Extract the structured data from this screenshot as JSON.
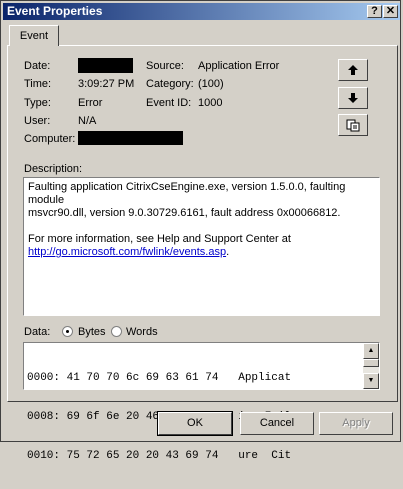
{
  "window": {
    "title": "Event Properties",
    "help_label": "?",
    "close_label": "✕"
  },
  "tabs": [
    {
      "label": "Event"
    }
  ],
  "event": {
    "date_label": "Date:",
    "date_value": "",
    "source_label": "Source:",
    "source_value": "Application Error",
    "time_label": "Time:",
    "time_value": "3:09:27 PM",
    "category_label": "Category:",
    "category_value": "(100)",
    "type_label": "Type:",
    "type_value": "Error",
    "event_id_label": "Event ID:",
    "event_id_value": "1000",
    "user_label": "User:",
    "user_value": "N/A",
    "computer_label": "Computer:",
    "computer_value": ""
  },
  "side_buttons": {
    "up_icon": "up-arrow-icon",
    "down_icon": "down-arrow-icon",
    "copy_icon": "copy-icon"
  },
  "description": {
    "label": "Description:",
    "line1": "Faulting application CitrixCseEngine.exe, version 1.5.0.0, faulting module",
    "line2": "msvcr90.dll, version 9.0.30729.6161, fault address 0x00066812.",
    "line3": "For more information, see Help and Support Center at",
    "link": "http://go.microsoft.com/fwlink/events.asp",
    "link_suffix": "."
  },
  "data_section": {
    "label": "Data:",
    "bytes_label": "Bytes",
    "words_label": "Words",
    "selected": "Bytes",
    "rows": [
      "0000: 41 70 70 6c 69 63 61 74   Applicat",
      "0008: 69 6f 6e 20 46 61 69 6c   ion Fail",
      "0010: 75 72 65 20 20 43 69 74   ure  Cit"
    ]
  },
  "buttons": {
    "ok": "OK",
    "cancel": "Cancel",
    "apply": "Apply"
  },
  "colors": {
    "title_start": "#0a246a",
    "title_end": "#a6caf0",
    "face": "#d4d0c8",
    "link": "#0000cc"
  }
}
